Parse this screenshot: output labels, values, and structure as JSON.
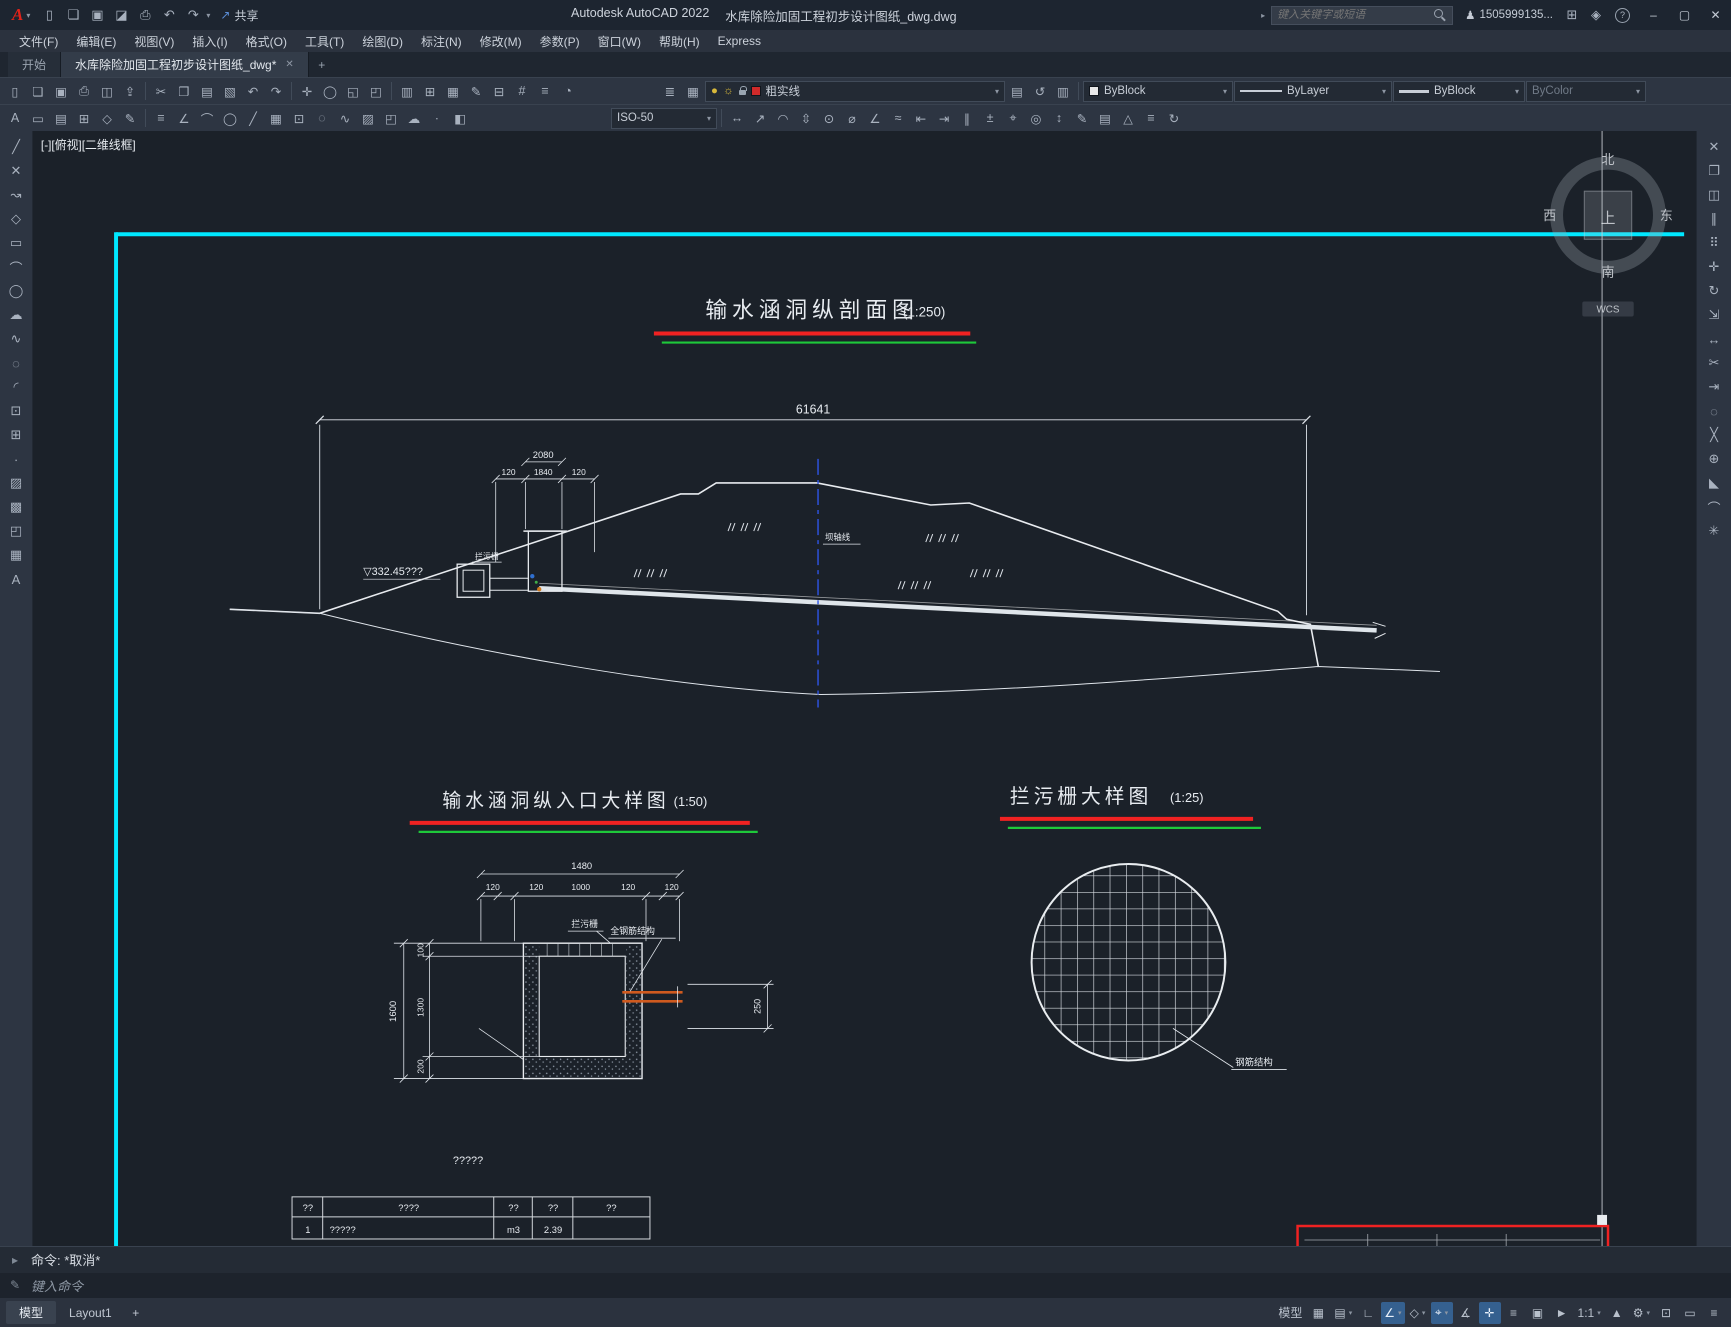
{
  "ui": {
    "caret": "▾"
  },
  "titlebar": {
    "logo_letter": "A",
    "qat": [
      "▯",
      "❏",
      "▣",
      "◪",
      "⎙",
      "↶",
      "↷"
    ],
    "share_icon": "↗",
    "share_label": "共享",
    "app_name": "Autodesk AutoCAD 2022",
    "doc_name": "水库除险加固工程初步设计图纸_dwg.dwg",
    "search_placeholder": "键入关键字或短语",
    "user_icon": "♟",
    "user_name": "1505999135...",
    "cart_icon": "⊞",
    "apps_icon": "◈",
    "help_label": "?",
    "win_min": "–",
    "win_max": "▢",
    "win_close": "✕"
  },
  "menubar": {
    "items": [
      "文件(F)",
      "编辑(E)",
      "视图(V)",
      "插入(I)",
      "格式(O)",
      "工具(T)",
      "绘图(D)",
      "标注(N)",
      "修改(M)",
      "参数(P)",
      "窗口(W)",
      "帮助(H)",
      "Express"
    ]
  },
  "tabbar": {
    "start": "开始",
    "file": "水库除险加固工程初步设计图纸_dwg*",
    "close": "✕",
    "add": "+"
  },
  "tb1": {
    "icons": [
      "▯",
      "❏",
      "▣",
      "⎙",
      "◫",
      "⇪",
      "✂",
      "❐",
      "▤",
      "▧",
      "↶",
      "↷",
      "✛",
      "◯",
      "◱",
      "◰",
      "▥",
      "⊞",
      "▦",
      "✎",
      "⊟",
      "#",
      "≡",
      "◔"
    ],
    "layer_tools": [
      "≣",
      "▦"
    ],
    "bulb": "●",
    "sun": "☼",
    "layer_value": "粗实线",
    "post_icons": [
      "▤",
      "↺",
      "▥"
    ],
    "color_value": "ByBlock",
    "linetype_value": "ByLayer",
    "lineweight_value": "ByBlock",
    "plotstyle_value": "ByColor"
  },
  "tb2": {
    "left_icons": [
      "A",
      "▭",
      "▤",
      "⊞",
      "◇",
      "✎",
      "≡",
      "∠",
      "⌒",
      "◯",
      "╱",
      "▦",
      "⊡",
      "◌",
      "∿",
      "▨",
      "◰",
      "☁",
      "∙",
      "◧"
    ],
    "style_value": "ISO-50",
    "right_icons": [
      "↔",
      "↗",
      "◠",
      "⇳",
      "⊙",
      "⌀",
      "∠",
      "≈",
      "⇤",
      "⇥",
      "∥",
      "±",
      "⌖",
      "◎",
      "↕",
      "✎",
      "▤",
      "△",
      "≡",
      "↻"
    ]
  },
  "ltb": {
    "icons": [
      "╱",
      "✕",
      "↝",
      "◇",
      "▭",
      "⌒",
      "◯",
      "☁",
      "∿",
      "◌",
      "◜",
      "⊡",
      "⊞",
      "∙",
      "▨",
      "▩",
      "◰",
      "▦",
      "A"
    ]
  },
  "rtb": {
    "icons": [
      "✕",
      "❐",
      "◫",
      "∥",
      "⠿",
      "✛",
      "↻",
      "⇲",
      "↔",
      "✂",
      "⇥",
      "◌",
      "╳",
      "⊕",
      "◣",
      "⌒",
      "✳"
    ]
  },
  "canvas": {
    "viewport": "[-][俯视][二维线框]",
    "compass": {
      "n": "北",
      "s": "南",
      "w": "西",
      "e": "东",
      "c": "上",
      "wcs": "WCS"
    },
    "colors": {
      "frame": "#00e8ff",
      "red": "#f02222",
      "green": "#1ec83a",
      "axis": "#2e55e8",
      "pipe": "#cf5a1f"
    },
    "d1": {
      "title": "输水涵洞纵剖面图",
      "scale": "(1:250)",
      "dim_total": "61641",
      "dim_top": "2080",
      "dim_a": "120",
      "dim_b": "1840",
      "dim_c": "120",
      "elev": "▽332.45???",
      "lbl_rack": "拦污栅",
      "lbl_axis": "坝轴线"
    },
    "d2": {
      "title": "输水涵洞纵入口大样图",
      "scale": "(1:50)",
      "dim_w": "1480",
      "t1": "120",
      "t2": "120",
      "t3": "1000",
      "t4": "120",
      "t5": "120",
      "dim_h": "1600",
      "l1": "100",
      "l2": "1300",
      "l3": "200",
      "dim_r": "250",
      "lbl_rack": "拦污栅",
      "lbl_steel": "全钢筋结构",
      "note": "?????"
    },
    "d3": {
      "title": "拦污栅大样图",
      "scale": "(1:25)",
      "lbl": "钢筋结构"
    },
    "table": {
      "h1": "??",
      "h2": "????",
      "h3": "??",
      "h4": "??",
      "h5": "??",
      "r1": "1",
      "r2": "?????",
      "r3": "m3",
      "r4": "2.39"
    }
  },
  "cmd": {
    "prompt": "命令: *取消*",
    "hint": "键入命令",
    "icon1": "▸",
    "icon2": "✎"
  },
  "status": {
    "model_tab": "模型",
    "layout_tab": "Layout1",
    "add": "+",
    "model_btn": "模型",
    "icons": [
      "▦",
      "▤",
      "∟",
      "∠",
      "◇",
      "⌖",
      "∡",
      "✛",
      "≡",
      "▣",
      "►"
    ],
    "scale": "1:1",
    "tail_icons": [
      "▲",
      "⚙",
      "⊡",
      "▭",
      "≡"
    ]
  }
}
